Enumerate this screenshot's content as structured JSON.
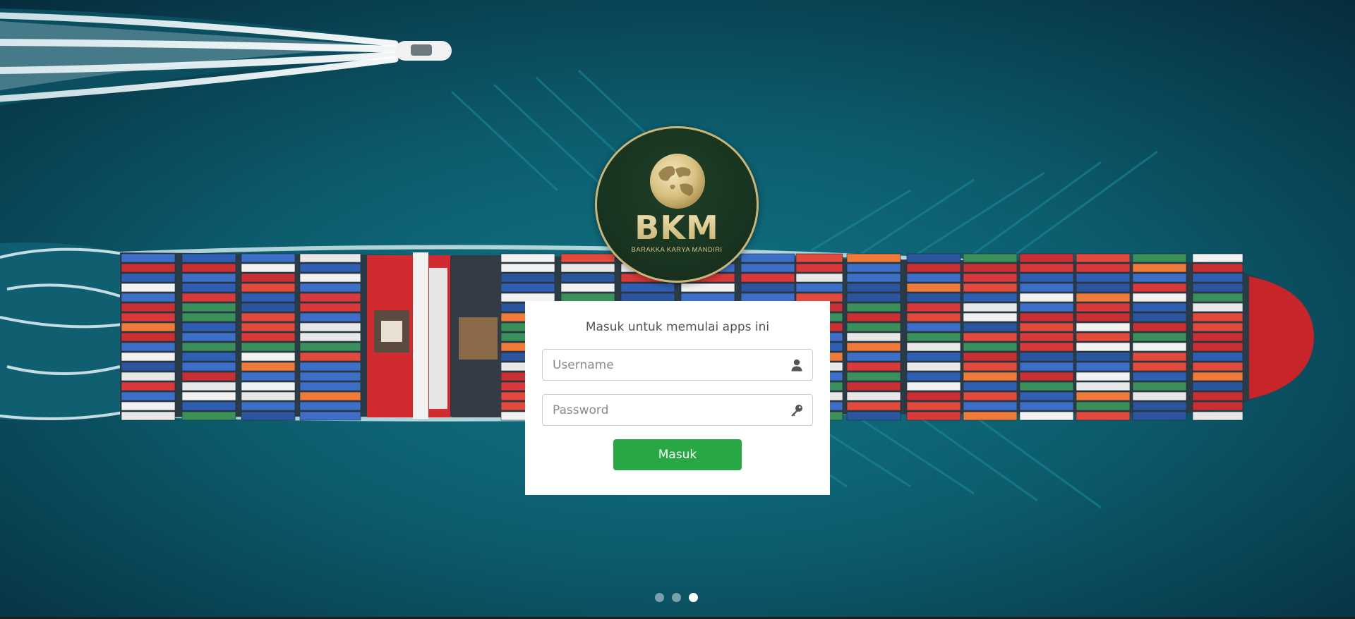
{
  "brand": {
    "mark": "BKM",
    "name": "BARAKKA KARYA MANDIRI",
    "primary_color": "#193420",
    "gold_color": "#d9c68e"
  },
  "login": {
    "title": "Masuk untuk memulai apps ini",
    "username_placeholder": "Username",
    "password_placeholder": "Password",
    "username_icon": "user-icon",
    "password_icon": "key-icon",
    "submit_label": "Masuk",
    "submit_color": "#28a745"
  },
  "carousel": {
    "slide_count": 3,
    "active_index": 3
  },
  "background": {
    "subject": "container-ship-aerial"
  }
}
